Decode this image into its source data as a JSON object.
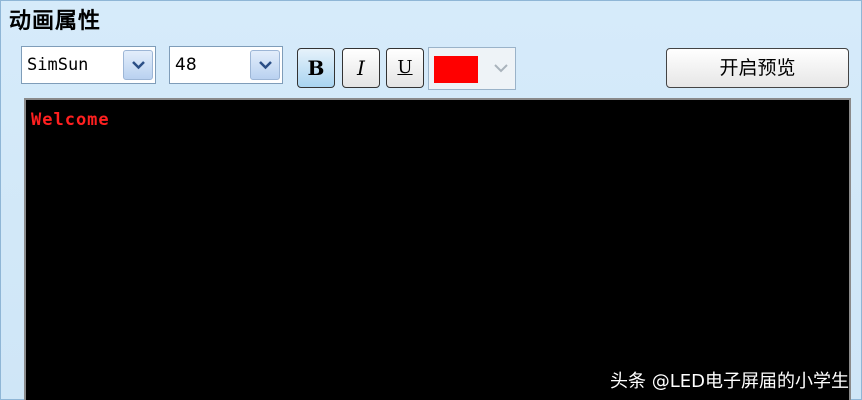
{
  "panel": {
    "title": "动画属性"
  },
  "toolbar": {
    "font_select": {
      "value": "SimSun"
    },
    "size_select": {
      "value": "48"
    },
    "bold_label": "B",
    "italic_label": "I",
    "underline_label": "U",
    "color_picker": {
      "selected_color": "#ff0000"
    },
    "preview_label": "开启预览"
  },
  "preview": {
    "text": "Welcome",
    "text_color": "#ff0000",
    "background": "#000000"
  },
  "watermark": "头条 @LED电子屏届的小学生"
}
